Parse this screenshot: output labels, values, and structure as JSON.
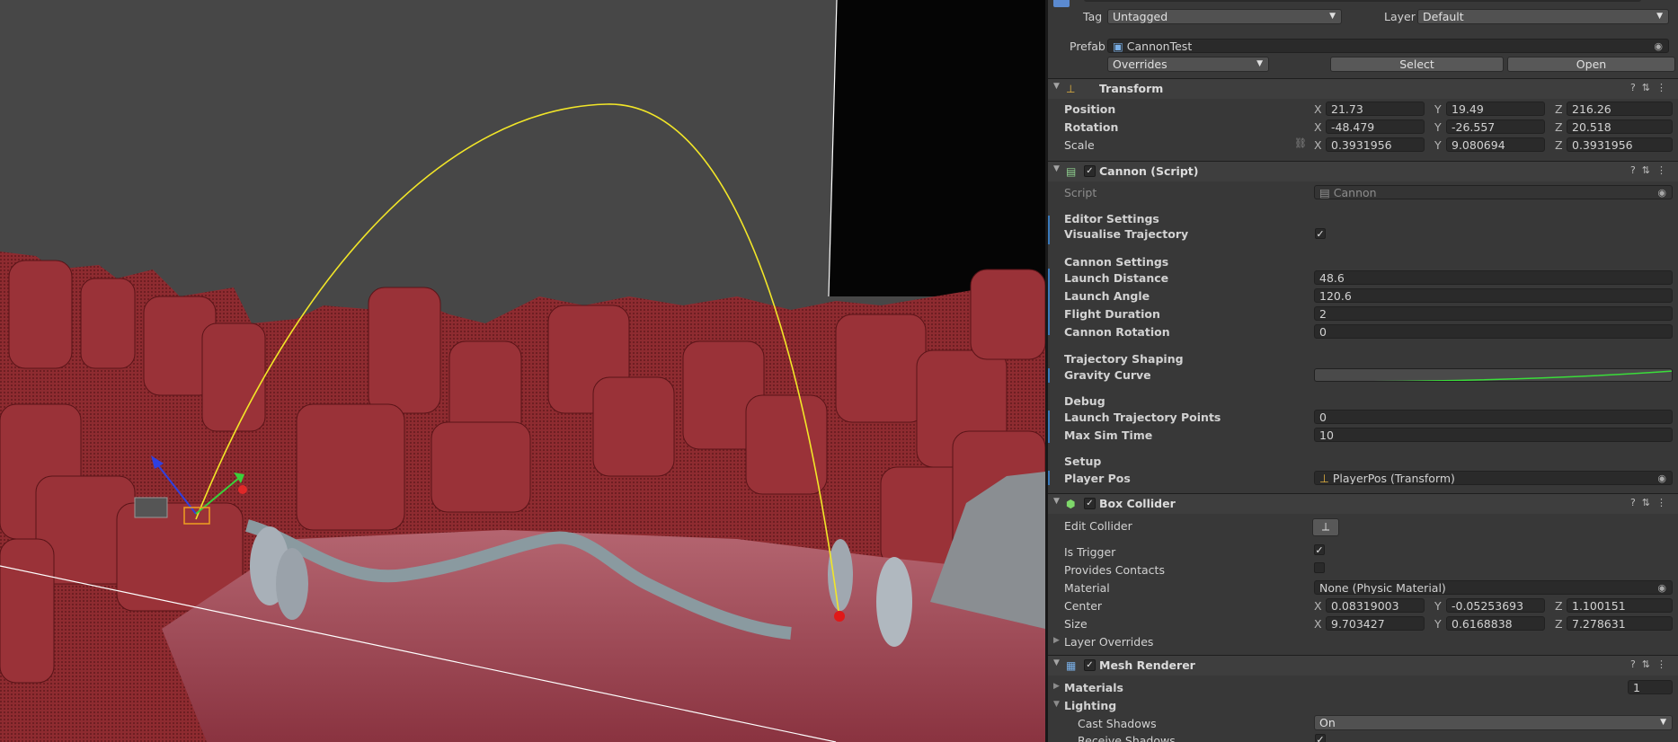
{
  "inspector": {
    "tag_label": "Tag",
    "tag_value": "Untagged",
    "layer_label": "Layer",
    "layer_value": "Default",
    "prefab_label": "Prefab",
    "prefab_value": "CannonTest",
    "overrides_value": "Overrides",
    "select_label": "Select",
    "open_label": "Open"
  },
  "transform": {
    "title": "Transform",
    "position_label": "Position",
    "rotation_label": "Rotation",
    "scale_label": "Scale",
    "axis_x": "X",
    "axis_y": "Y",
    "axis_z": "Z",
    "position": {
      "x": "21.73",
      "y": "19.49",
      "z": "216.26"
    },
    "rotation": {
      "x": "-48.479",
      "y": "-26.557",
      "z": "20.518"
    },
    "scale": {
      "x": "0.3931956",
      "y": "9.080694",
      "z": "0.3931956"
    }
  },
  "cannon": {
    "title": "Cannon (Script)",
    "script_label": "Script",
    "script_value": "Cannon",
    "editor_settings": "Editor Settings",
    "visualise_trajectory": "Visualise Trajectory",
    "cannon_settings": "Cannon Settings",
    "launch_distance_label": "Launch Distance",
    "launch_distance": "48.6",
    "launch_angle_label": "Launch Angle",
    "launch_angle": "120.6",
    "flight_duration_label": "Flight Duration",
    "flight_duration": "2",
    "cannon_rotation_label": "Cannon Rotation",
    "cannon_rotation": "0",
    "trajectory_shaping": "Trajectory Shaping",
    "gravity_curve_label": "Gravity Curve",
    "debug": "Debug",
    "launch_points_label": "Launch Trajectory Points",
    "launch_points": "0",
    "max_sim_time_label": "Max Sim Time",
    "max_sim_time": "10",
    "setup": "Setup",
    "player_pos_label": "Player Pos",
    "player_pos_value": "PlayerPos (Transform)"
  },
  "box_collider": {
    "title": "Box Collider",
    "edit_collider": "Edit Collider",
    "is_trigger": "Is Trigger",
    "provides_contacts": "Provides Contacts",
    "material_label": "Material",
    "material_value": "None (Physic Material)",
    "center_label": "Center",
    "size_label": "Size",
    "center": {
      "x": "0.08319003",
      "y": "-0.05253693",
      "z": "1.100151"
    },
    "size": {
      "x": "9.703427",
      "y": "0.6168838",
      "z": "7.278631"
    },
    "layer_overrides": "Layer Overrides"
  },
  "mesh_renderer": {
    "title": "Mesh Renderer",
    "materials_label": "Materials",
    "materials_count": "1",
    "lighting_label": "Lighting",
    "cast_shadows_label": "Cast Shadows",
    "cast_shadows_value": "On",
    "receive_shadows_label": "Receive Shadows"
  },
  "colors": {
    "trajectory": "#f2e628",
    "terrain": "#8a2a2e",
    "accent_bar": "#3a79bb"
  }
}
